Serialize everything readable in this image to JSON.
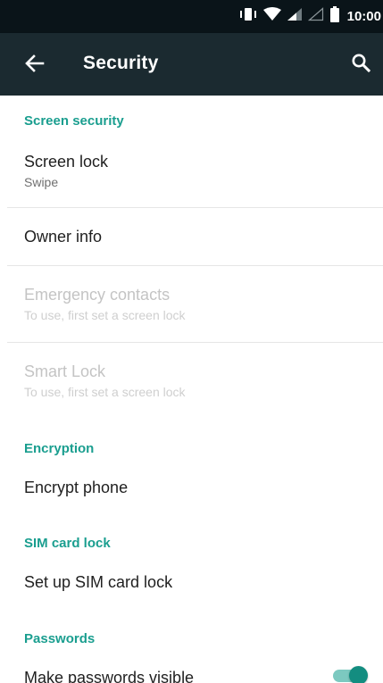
{
  "status_bar": {
    "time": "10:00",
    "icons": [
      "vibrate-icon",
      "wifi-icon",
      "signal-icon",
      "signal-icon-2",
      "battery-icon"
    ]
  },
  "app_bar": {
    "title": "Security",
    "back_icon": "arrow-back-icon",
    "search_icon": "search-icon"
  },
  "colors": {
    "status_bar_bg": "#0a1419",
    "app_bar_bg": "#1b2a30",
    "accent": "#1a9e8f",
    "toggle_thumb": "#138d80",
    "toggle_track": "#7cc9c0"
  },
  "sections": {
    "screen_security": {
      "header": "Screen security",
      "screen_lock": {
        "title": "Screen lock",
        "summary": "Swipe"
      },
      "owner_info": {
        "title": "Owner info"
      },
      "emergency_contacts": {
        "title": "Emergency contacts",
        "summary": "To use, first set a screen lock"
      },
      "smart_lock": {
        "title": "Smart Lock",
        "summary": "To use, first set a screen lock"
      }
    },
    "encryption": {
      "header": "Encryption",
      "encrypt_phone": {
        "title": "Encrypt phone"
      }
    },
    "sim_card_lock": {
      "header": "SIM card lock",
      "set_up": {
        "title": "Set up SIM card lock"
      }
    },
    "passwords": {
      "header": "Passwords",
      "make_visible": {
        "title": "Make passwords visible",
        "checked": true
      }
    }
  }
}
